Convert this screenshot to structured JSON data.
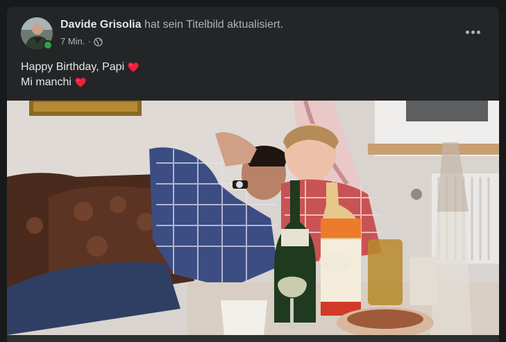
{
  "post": {
    "author": "Davide Grisolia",
    "action": "hat sein Titelbild aktualisiert.",
    "time": "7 Min.",
    "separator": "·",
    "privacy_icon": "globe-icon",
    "more_icon": "more-horizontal-icon",
    "text_lines": [
      {
        "text": "Happy Birthday, Papi",
        "emoji": "red-heart"
      },
      {
        "text": "Mi manchi",
        "emoji": "red-heart"
      }
    ]
  },
  "colors": {
    "card": "#242526",
    "page": "#18191a",
    "primary_text": "#e4e6eb",
    "secondary_text": "#b0b3b8",
    "online": "#31a24c",
    "heart": "#f0213f"
  }
}
